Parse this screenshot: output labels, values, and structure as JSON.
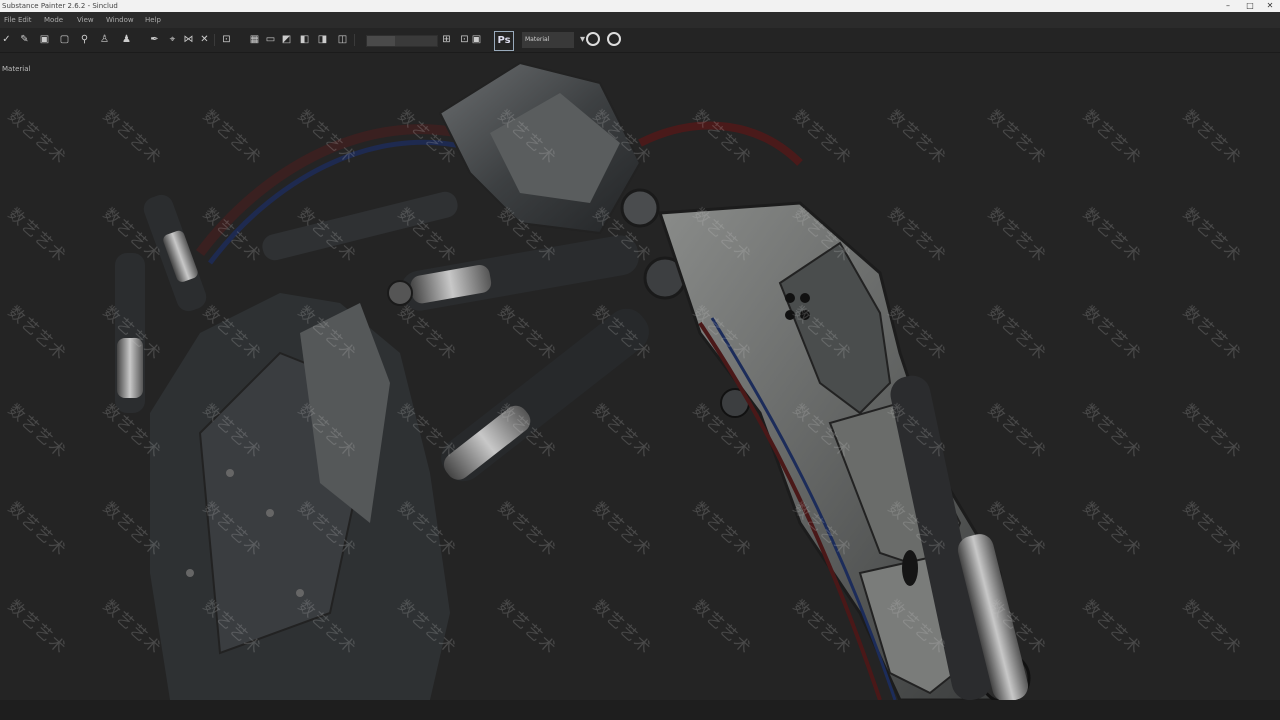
{
  "window": {
    "title": "Substance Painter 2.6.2 - Sinclud",
    "controls": [
      "minimize-icon",
      "maximize-icon",
      "close-icon"
    ]
  },
  "menu": [
    "File",
    "Edit",
    "Mode",
    "View",
    "Window",
    "Help"
  ],
  "toolbar": {
    "ps_label": "Ps",
    "dropdown_value": "Material"
  },
  "viewport": {
    "label": "Material",
    "subject": "mechanical-claw-model"
  },
  "watermark": "数艺艺术"
}
